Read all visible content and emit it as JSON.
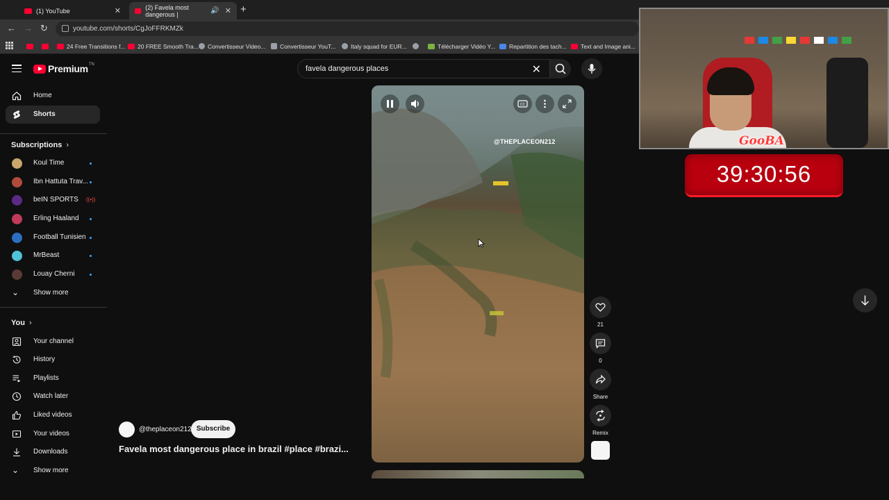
{
  "browser": {
    "tabs": [
      {
        "title": "(1) YouTube",
        "active": false
      },
      {
        "title": "(2) Favela most dangerous |",
        "active": true
      }
    ],
    "url": "youtube.com/shorts/CgJoFFRKMZk",
    "bookmarks": [
      {
        "label": "",
        "icon": "youtube-icon"
      },
      {
        "label": "",
        "icon": "youtube-icon"
      },
      {
        "label": "24 Free Transitions f...",
        "icon": "youtube-icon"
      },
      {
        "label": "20 FREE Smooth Tra...",
        "icon": "youtube-icon"
      },
      {
        "label": "Convertisseur Video...",
        "icon": "globe-icon"
      },
      {
        "label": "Convertisseur YouT...",
        "icon": "site-icon"
      },
      {
        "label": "Italy squad for EUR...",
        "icon": "globe-icon"
      },
      {
        "label": "",
        "icon": "globe-icon"
      },
      {
        "label": "Télécharger Vidéo Y...",
        "icon": "download-icon"
      },
      {
        "label": "Repartition des tach...",
        "icon": "docs-icon"
      },
      {
        "label": "Text and Image ani...",
        "icon": "youtube-icon"
      }
    ]
  },
  "masthead": {
    "logo_text": "Premium",
    "logo_sup": "TN",
    "search_query": "favela dangerous places"
  },
  "sidebar": {
    "main": [
      {
        "label": "Home",
        "icon": "home-icon"
      },
      {
        "label": "Shorts",
        "icon": "shorts-icon",
        "active": true
      }
    ],
    "subscriptions_title": "Subscriptions",
    "subscriptions": [
      {
        "label": "Koul Time",
        "color": "#c9a66b",
        "status": "dot"
      },
      {
        "label": "Ibn Hattuta Trav...",
        "color": "#b04a3a",
        "status": "dot"
      },
      {
        "label": "beIN SPORTS",
        "color": "#5b2a86",
        "status": "live"
      },
      {
        "label": "Erling Haaland",
        "color": "#c23a5a",
        "status": "dot"
      },
      {
        "label": "Football Tunisien",
        "color": "#2c6fbf",
        "status": "dot"
      },
      {
        "label": "MrBeast",
        "color": "#4fc3d7",
        "status": "dot"
      },
      {
        "label": "Louay Cherni",
        "color": "#5a3a34",
        "status": "dot"
      }
    ],
    "show_more_1": "Show more",
    "you_title": "You",
    "you_items": [
      {
        "label": "Your channel",
        "icon": "channel-icon"
      },
      {
        "label": "History",
        "icon": "history-icon"
      },
      {
        "label": "Playlists",
        "icon": "playlists-icon"
      },
      {
        "label": "Watch later",
        "icon": "clock-icon"
      },
      {
        "label": "Liked videos",
        "icon": "thumbs-up-icon"
      },
      {
        "label": "Your videos",
        "icon": "video-icon"
      },
      {
        "label": "Downloads",
        "icon": "download-icon"
      }
    ],
    "show_more_2": "Show more"
  },
  "short": {
    "watermark": "@THEPLACEON212",
    "channel": "@theplaceon212",
    "subscribe_label": "Subscribe",
    "title": "Favela most dangerous place in brazil #place #brazi...",
    "likes": "21",
    "comments": "0",
    "share_label": "Share",
    "remix_label": "Remix"
  },
  "overlay": {
    "cam_tag": "GooBA",
    "timer": "39:30:56"
  },
  "colors": {
    "youtube_red": "#ff0033",
    "background": "#0f0f0f",
    "timer_red": "#b8000f"
  }
}
